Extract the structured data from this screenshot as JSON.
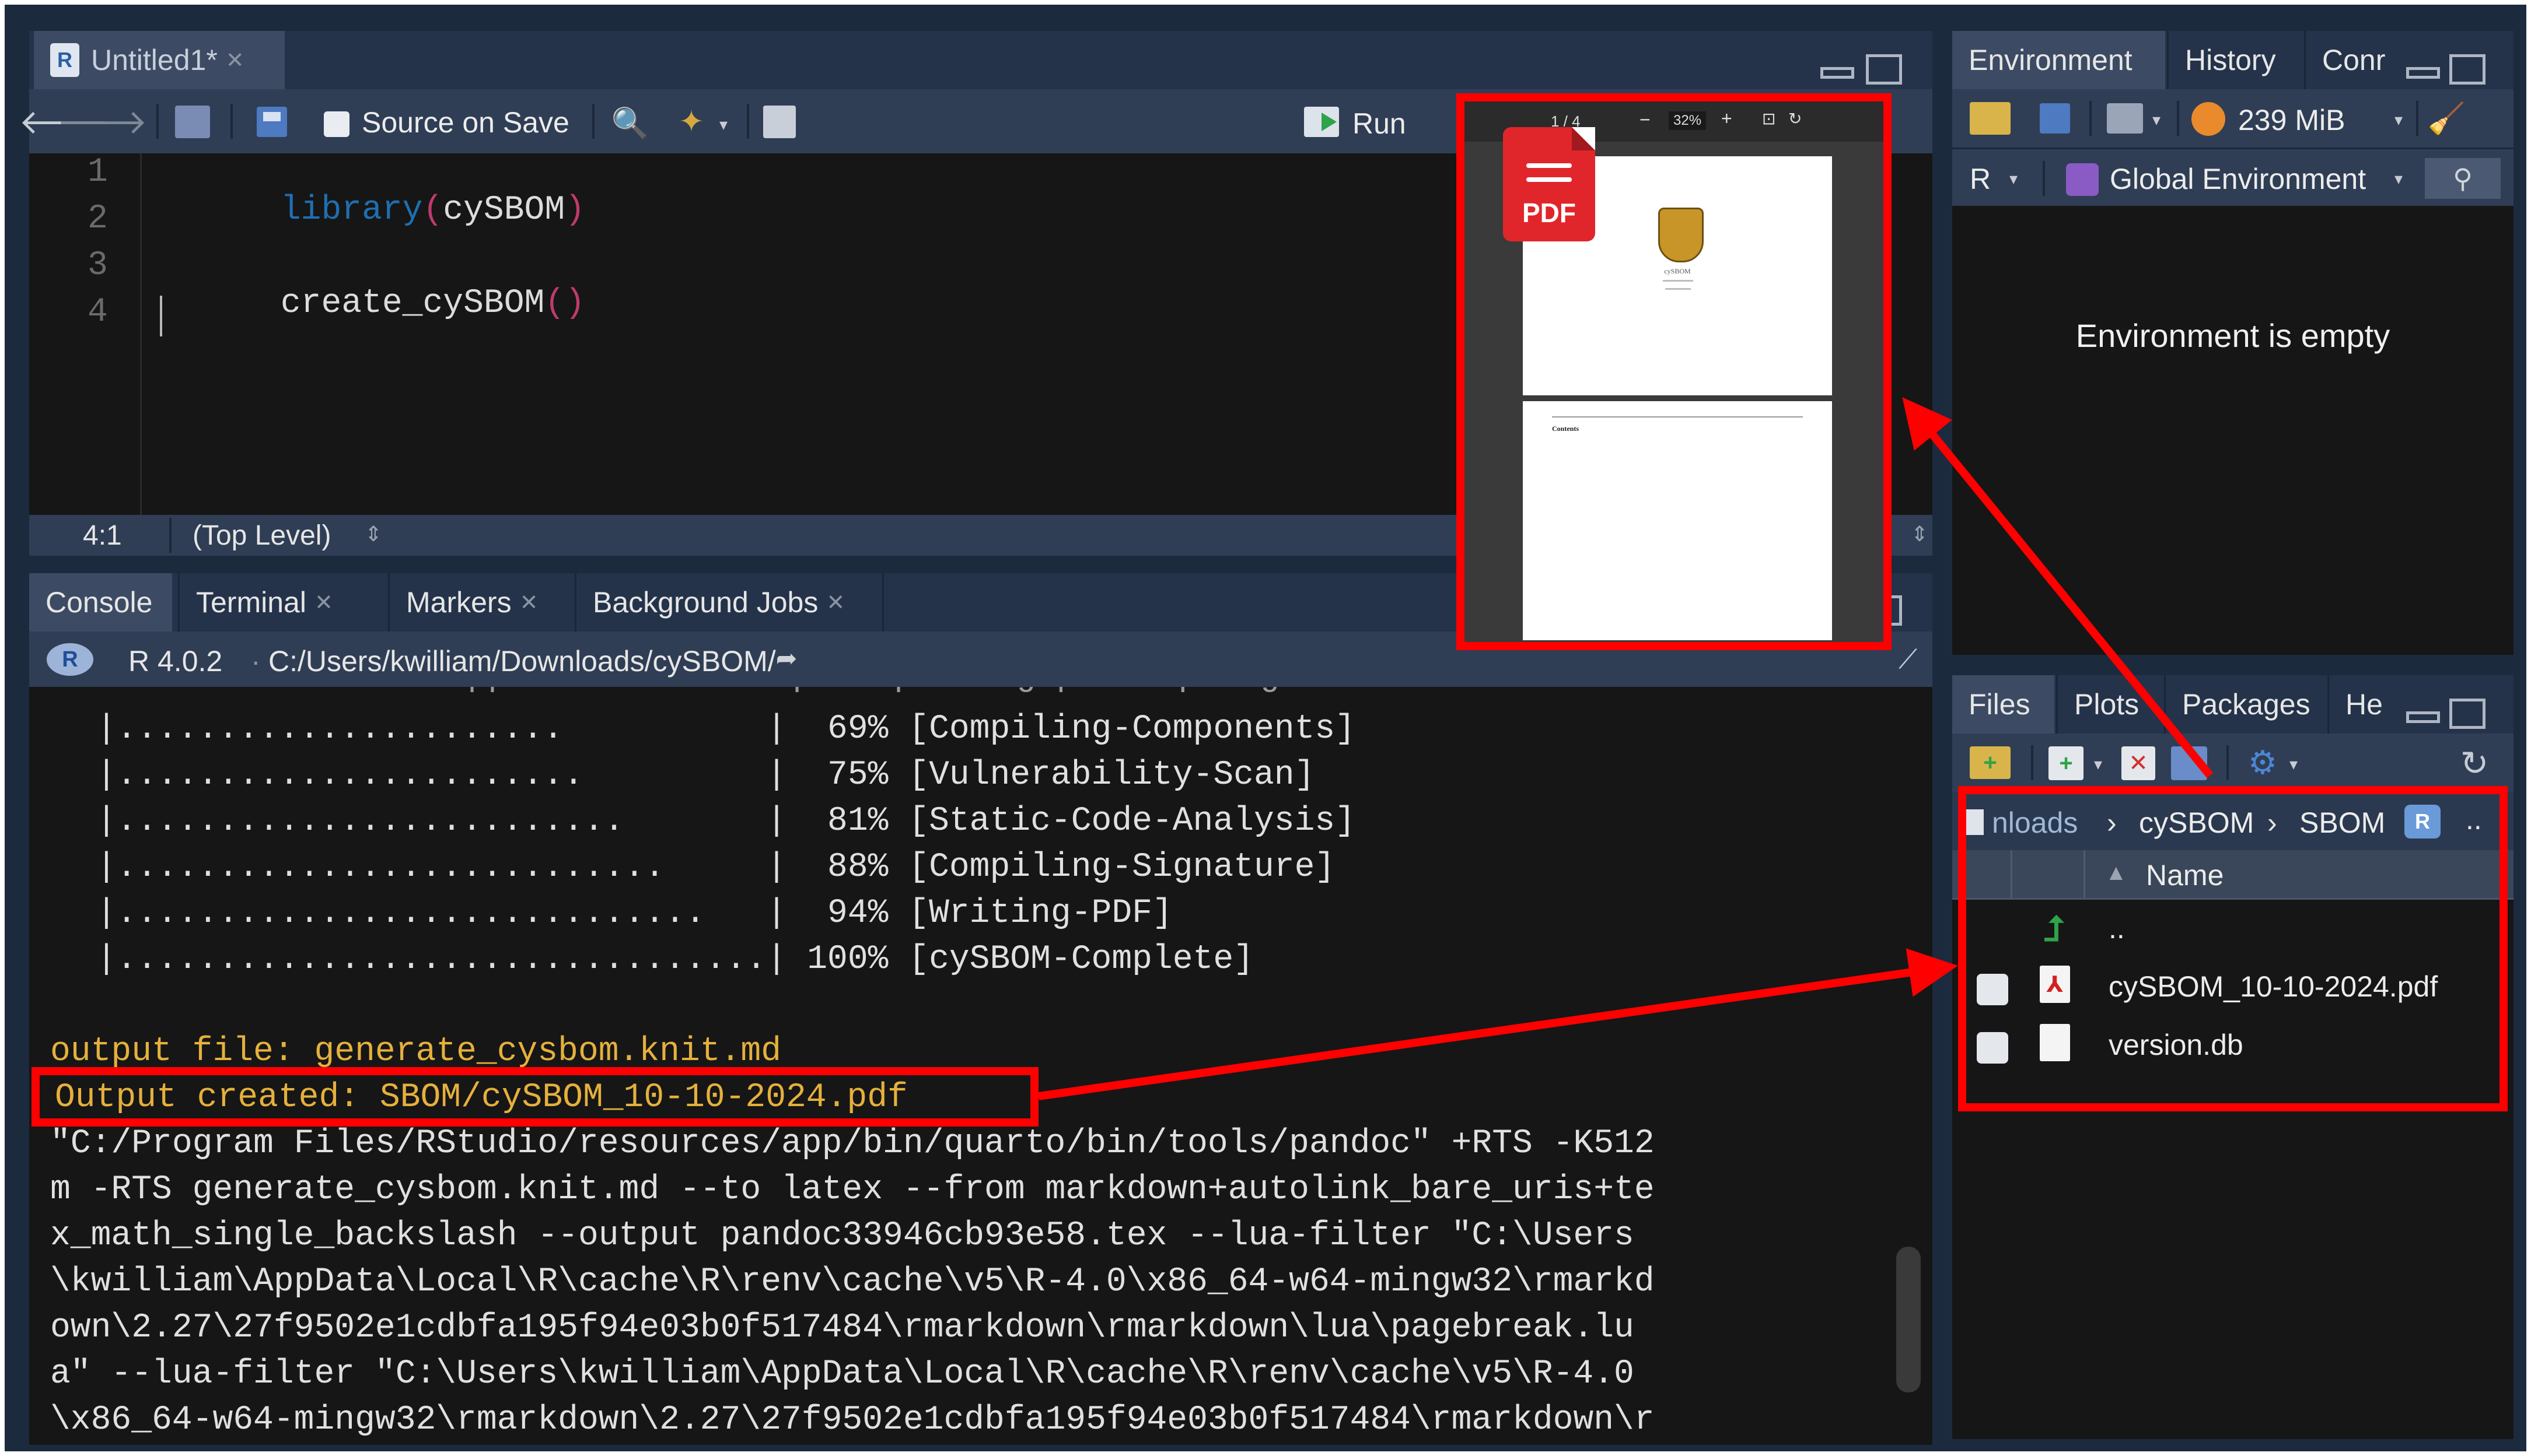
{
  "editor": {
    "tab_title": "Untitled1*",
    "toolbar": {
      "source_on_save": "Source on Save",
      "run": "Run"
    },
    "lines": [
      {
        "num": "1",
        "fn": "library",
        "open": "(",
        "arg": "cySBOM",
        "close": ")"
      },
      {
        "num": "2"
      },
      {
        "num": "3",
        "fn": "create_cySBOM",
        "open": "(",
        "close": ")"
      },
      {
        "num": "4"
      }
    ],
    "status": {
      "position": "4:1",
      "scope": "(Top Level)"
    }
  },
  "console": {
    "tabs": [
      "Console",
      "Terminal",
      "Markers",
      "Background Jobs"
    ],
    "r_version": "R 4.0.2",
    "path": "C:/Users/kwilliam/Downloads/cySBOM/",
    "progress_rows": [
      {
        "bar": "|......................          |",
        "pct": "69%",
        "label": "[Compiling-Components]"
      },
      {
        "bar": "|.......................         |",
        "pct": "75%",
        "label": "[Vulnerability-Scan]"
      },
      {
        "bar": "|.........................       |",
        "pct": "81%",
        "label": "[Static-Code-Analysis]"
      },
      {
        "bar": "|...........................     |",
        "pct": "88%",
        "label": "[Compiling-Signature]"
      },
      {
        "bar": "|.............................   |",
        "pct": "94%",
        "label": "[Writing-PDF]"
      },
      {
        "bar": "|................................|",
        "pct": "100%",
        "label": "[cySBOM-Complete]"
      }
    ],
    "output_file": "output file: generate_cysbom.knit.md",
    "output_created": "Output created: SBOM/cySBOM_10-10-2024.pdf",
    "pandoc_lines": [
      "\"C:/Program Files/RStudio/resources/app/bin/quarto/bin/tools/pandoc\" +RTS -K512",
      "m -RTS generate_cysbom.knit.md --to latex --from markdown+autolink_bare_uris+te",
      "x_math_single_backslash --output pandoc33946cb93e58.tex --lua-filter \"C:\\Users",
      "\\kwilliam\\AppData\\Local\\R\\cache\\R\\renv\\cache\\v5\\R-4.0\\x86_64-w64-mingw32\\rmarkd",
      "own\\2.27\\27f9502e1cdbfa195f94e03b0f517484\\rmarkdown\\rmarkdown\\lua\\pagebreak.lu",
      "a\" --lua-filter \"C:\\Users\\kwilliam\\AppData\\Local\\R\\cache\\R\\renv\\cache\\v5\\R-4.0",
      "\\x86_64-w64-mingw32\\rmarkdown\\2.27\\27f9502e1cdbfa195f94e03b0f517484\\rmarkdown\\r"
    ]
  },
  "environment": {
    "tabs": [
      "Environment",
      "History",
      "Conr"
    ],
    "memory": "239 MiB",
    "language": "R",
    "scope": "Global Environment",
    "empty_message": "Environment is empty"
  },
  "files": {
    "tabs": [
      "Files",
      "Plots",
      "Packages",
      "He"
    ],
    "breadcrumb": [
      "nloads",
      "cySBOM",
      "SBOM"
    ],
    "column_name": "Name",
    "up_label": "..",
    "items": [
      {
        "name": "cySBOM_10-10-2024.pdf",
        "type": "pdf-icon"
      },
      {
        "name": "version.db",
        "type": "file-icon"
      }
    ]
  },
  "pdf_preview": {
    "page_indicator": "1 / 4",
    "zoom": "32%",
    "badge": "PDF",
    "doc_title": "cySBOM",
    "toc_heading": "Contents"
  },
  "colors": {
    "highlight": "#ff0000",
    "accent_orange": "#e5b03c",
    "keyword": "#1f6fb2"
  }
}
